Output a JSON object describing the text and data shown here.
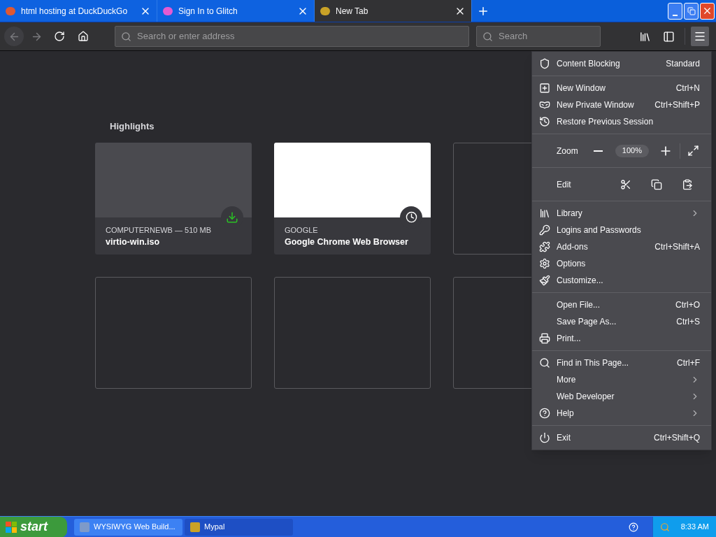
{
  "tabs": [
    {
      "title": "html hosting at DuckDuckGo",
      "selected": false
    },
    {
      "title": "Sign In to Glitch",
      "selected": false
    },
    {
      "title": "New Tab",
      "selected": true
    }
  ],
  "toolbar": {
    "address_placeholder": "Search or enter address",
    "search_placeholder": "Search"
  },
  "highlights": {
    "title": "Highlights",
    "cards": [
      {
        "kind": "download",
        "context": "COMPUTERNEWB — 510 MB",
        "title": "virtio-win.iso"
      },
      {
        "kind": "history",
        "context": "GOOGLE",
        "title": "Google Chrome Web Browser"
      },
      {
        "kind": "empty"
      },
      {
        "kind": "empty"
      },
      {
        "kind": "empty"
      },
      {
        "kind": "empty"
      }
    ]
  },
  "menu": {
    "groups": [
      [
        {
          "kind": "item",
          "label": "Content Blocking",
          "shortcut": "Standard"
        }
      ],
      [
        {
          "kind": "item",
          "label": "New Window",
          "shortcut": "Ctrl+N"
        },
        {
          "kind": "item",
          "label": "New Private Window",
          "shortcut": "Ctrl+Shift+P"
        },
        {
          "kind": "item",
          "label": "Restore Previous Session"
        }
      ],
      [
        {
          "kind": "zoom",
          "label": "Zoom",
          "value": "100%"
        }
      ],
      [
        {
          "kind": "edit",
          "label": "Edit"
        }
      ],
      [
        {
          "kind": "item",
          "label": "Library",
          "submenu": true
        },
        {
          "kind": "item",
          "label": "Logins and Passwords"
        },
        {
          "kind": "item",
          "label": "Add-ons",
          "shortcut": "Ctrl+Shift+A"
        },
        {
          "kind": "item",
          "label": "Options"
        },
        {
          "kind": "item",
          "label": "Customize..."
        }
      ],
      [
        {
          "kind": "item",
          "label": "Open File...",
          "shortcut": "Ctrl+O"
        },
        {
          "kind": "item",
          "label": "Save Page As...",
          "shortcut": "Ctrl+S"
        },
        {
          "kind": "item",
          "label": "Print..."
        }
      ],
      [
        {
          "kind": "item",
          "label": "Find in This Page...",
          "shortcut": "Ctrl+F"
        },
        {
          "kind": "item",
          "label": "More",
          "submenu": true
        },
        {
          "kind": "item",
          "label": "Web Developer",
          "submenu": true
        },
        {
          "kind": "item",
          "label": "Help",
          "submenu": true
        }
      ],
      [
        {
          "kind": "item",
          "label": "Exit",
          "shortcut": "Ctrl+Shift+Q"
        }
      ]
    ]
  },
  "taskbar": {
    "start": "start",
    "tasks": [
      {
        "title": "WYSIWYG Web Build...",
        "selected": false
      },
      {
        "title": "Mypal",
        "selected": true
      }
    ],
    "clock": "8:33 AM"
  }
}
